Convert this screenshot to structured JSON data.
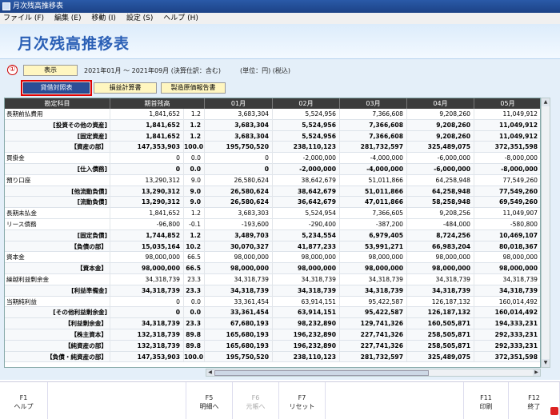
{
  "window": {
    "title": "月次残高推移表"
  },
  "menu": [
    "ファイル (F)",
    "編集 (E)",
    "移動 (I)",
    "設定 (S)",
    "ヘルプ (H)"
  ],
  "page_title": "月次残高推移表",
  "annotation": "①",
  "show_button": "表示",
  "period_info": "2021年01月 ～ 2021年09月 (決算仕訳：含む)",
  "unit_info": "(単位：円) (税込)",
  "tabs": [
    "貸借対照表",
    "損益計算書",
    "製造原価報告書"
  ],
  "columns": [
    "勘定科目",
    "期首残高",
    "01月",
    "02月",
    "03月",
    "04月",
    "05月"
  ],
  "rows": [
    {
      "name": "長期前払費用",
      "bold": false,
      "v": [
        "1,841,652",
        "1.2",
        "3,683,304",
        "5,524,956",
        "7,366,608",
        "9,208,260",
        "11,049,912"
      ]
    },
    {
      "name": "[投資その他の資産]",
      "bold": true,
      "v": [
        "1,841,652",
        "1.2",
        "3,683,304",
        "5,524,956",
        "7,366,608",
        "9,208,260",
        "11,049,912"
      ]
    },
    {
      "name": "[固定資産]",
      "bold": true,
      "v": [
        "1,841,652",
        "1.2",
        "3,683,304",
        "5,524,956",
        "7,366,608",
        "9,208,260",
        "11,049,912"
      ]
    },
    {
      "name": "【資産の部】",
      "bold": true,
      "v": [
        "147,353,903",
        "100.0",
        "195,750,520",
        "238,110,123",
        "281,732,597",
        "325,489,075",
        "372,351,598"
      ]
    },
    {
      "name": "買掛金",
      "bold": false,
      "v": [
        "0",
        "0.0",
        "0",
        "-2,000,000",
        "-4,000,000",
        "-6,000,000",
        "-8,000,000"
      ]
    },
    {
      "name": "[仕入債務]",
      "bold": true,
      "v": [
        "0",
        "0.0",
        "0",
        "-2,000,000",
        "-4,000,000",
        "-6,000,000",
        "-8,000,000"
      ]
    },
    {
      "name": "預り口座",
      "bold": false,
      "v": [
        "13,290,312",
        "9.0",
        "26,580,624",
        "38,642,679",
        "51,011,866",
        "64,258,948",
        "77,549,260"
      ]
    },
    {
      "name": "[他流動負債]",
      "bold": true,
      "v": [
        "13,290,312",
        "9.0",
        "26,580,624",
        "38,642,679",
        "51,011,866",
        "64,258,948",
        "77,549,260"
      ]
    },
    {
      "name": "[流動負債]",
      "bold": true,
      "v": [
        "13,290,312",
        "9.0",
        "26,580,624",
        "36,642,679",
        "47,011,866",
        "58,258,948",
        "69,549,260"
      ]
    },
    {
      "name": "長期未払金",
      "bold": false,
      "v": [
        "1,841,652",
        "1.2",
        "3,683,303",
        "5,524,954",
        "7,366,605",
        "9,208,256",
        "11,049,907"
      ]
    },
    {
      "name": "リース債務",
      "bold": false,
      "v": [
        "-96,800",
        "-0.1",
        "-193,600",
        "-290,400",
        "-387,200",
        "-484,000",
        "-580,800"
      ]
    },
    {
      "name": "[固定負債]",
      "bold": true,
      "v": [
        "1,744,852",
        "1.2",
        "3,489,703",
        "5,234,554",
        "6,979,405",
        "8,724,256",
        "10,469,107"
      ]
    },
    {
      "name": "【負債の部】",
      "bold": true,
      "v": [
        "15,035,164",
        "10.2",
        "30,070,327",
        "41,877,233",
        "53,991,271",
        "66,983,204",
        "80,018,367"
      ]
    },
    {
      "name": "資本金",
      "bold": false,
      "v": [
        "98,000,000",
        "66.5",
        "98,000,000",
        "98,000,000",
        "98,000,000",
        "98,000,000",
        "98,000,000"
      ]
    },
    {
      "name": "【資本金】",
      "bold": true,
      "v": [
        "98,000,000",
        "66.5",
        "98,000,000",
        "98,000,000",
        "98,000,000",
        "98,000,000",
        "98,000,000"
      ]
    },
    {
      "name": "繰越利益剰余金",
      "bold": false,
      "v": [
        "34,318,739",
        "23.3",
        "34,318,739",
        "34,318,739",
        "34,318,739",
        "34,318,739",
        "34,318,739"
      ]
    },
    {
      "name": "[利益準備金]",
      "bold": true,
      "v": [
        "34,318,739",
        "23.3",
        "34,318,739",
        "34,318,739",
        "34,318,739",
        "34,318,739",
        "34,318,739"
      ]
    },
    {
      "name": "当期純利益",
      "bold": false,
      "v": [
        "0",
        "0.0",
        "33,361,454",
        "63,914,151",
        "95,422,587",
        "126,187,132",
        "160,014,492"
      ]
    },
    {
      "name": "[その他利益剰余金]",
      "bold": true,
      "v": [
        "0",
        "0.0",
        "33,361,454",
        "63,914,151",
        "95,422,587",
        "126,187,132",
        "160,014,492"
      ]
    },
    {
      "name": "【利益剰余金】",
      "bold": true,
      "v": [
        "34,318,739",
        "23.3",
        "67,680,193",
        "98,232,890",
        "129,741,326",
        "160,505,871",
        "194,333,231"
      ]
    },
    {
      "name": "【株主資本】",
      "bold": true,
      "v": [
        "132,318,739",
        "89.8",
        "165,680,193",
        "196,232,890",
        "227,741,326",
        "258,505,871",
        "292,333,231"
      ]
    },
    {
      "name": "【純資産の部】",
      "bold": true,
      "v": [
        "132,318,739",
        "89.8",
        "165,680,193",
        "196,232,890",
        "227,741,326",
        "258,505,871",
        "292,333,231"
      ]
    },
    {
      "name": "【負債・純資産の部】",
      "bold": true,
      "v": [
        "147,353,903",
        "100.0",
        "195,750,520",
        "238,110,123",
        "281,732,597",
        "325,489,075",
        "372,351,598"
      ]
    }
  ],
  "fkeys": [
    {
      "key": "F1",
      "label": "ヘルプ",
      "disabled": false
    },
    {
      "key": "F5",
      "label": "明細へ",
      "disabled": false
    },
    {
      "key": "F6",
      "label": "元帳へ",
      "disabled": true
    },
    {
      "key": "F7",
      "label": "リセット",
      "disabled": false
    },
    {
      "key": "F11",
      "label": "印刷",
      "disabled": false
    },
    {
      "key": "F12",
      "label": "終了",
      "disabled": false
    }
  ]
}
